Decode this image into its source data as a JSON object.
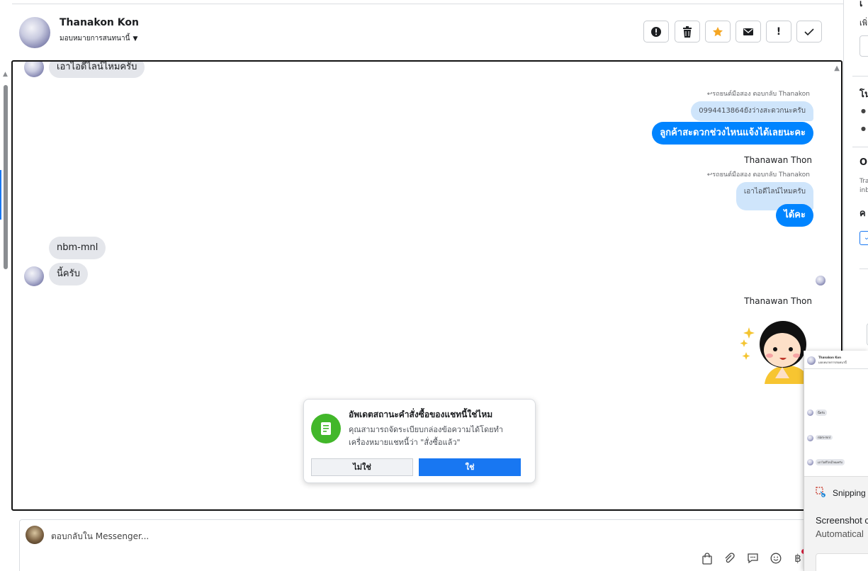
{
  "header": {
    "contact_name": "Thanakon Kon",
    "assign_label": "มอบหมายการสนทนานี้",
    "toolbar_icons": [
      "alert-icon",
      "trash-icon",
      "star-icon",
      "mail-icon",
      "exclamation-icon",
      "check-icon"
    ],
    "star_color": "#f5a623"
  },
  "messages": {
    "m1_text": "เอาไอดีไลน์ไหมครับ",
    "m2_meta": "รถยนต์มือสอง ตอบกลับ Thanakon",
    "m2_quote": "0994413864ยังว่างสะดวกนะครับ",
    "m2_text": "ลูกค้าสะดวกช่วงไหนแจ้งได้เลยนะคะ",
    "m3_sender": "Thanawan Thon",
    "m3_meta": "รถยนต์มือสอง ตอบกลับ Thanakon",
    "m3_quote": "เอาไอดีไลน์ไหมครับ",
    "m3_text": "ได้คะ",
    "m4_text": "nbm-mnl",
    "m5_text": "นี้ครับ",
    "m6_sender": "Thanawan Thon"
  },
  "popup": {
    "title": "อัพเดตสถานะคำสั่งซื้อของแชทนี้ใช่ไหม",
    "desc": "คุณสามารถจัดระเบียบกล่องข้อความได้โดยทำเครื่องหมายแชทนี้ว่า \"สั่งซื้อแล้ว\"",
    "no_label": "ไม่ใช่",
    "yes_label": "ใช่",
    "icon_color": "#42b72a"
  },
  "reply": {
    "placeholder": "ตอบกลับใน Messenger...",
    "icons": [
      "shopping-bag-icon",
      "attachment-icon",
      "saved-reply-icon",
      "emoji-icon",
      "baht-icon"
    ]
  },
  "right_panel": {
    "t1": "เ",
    "t2": "เพิ่",
    "t3": "โน",
    "t4": "O",
    "t5": "Tra",
    "t6": "inb",
    "t7": "ค"
  },
  "overlay": {
    "name": "Thanakon Kon",
    "sub": "มอบหมายการสนทนานี้",
    "row1": "นี้ครับ",
    "row2": "nbm-mnl",
    "row3": "เอาไอดีไลน์ไหมครับ",
    "snip_label": "Snipping",
    "notif_title": "Screenshot c",
    "notif_sub": "Automatical"
  }
}
